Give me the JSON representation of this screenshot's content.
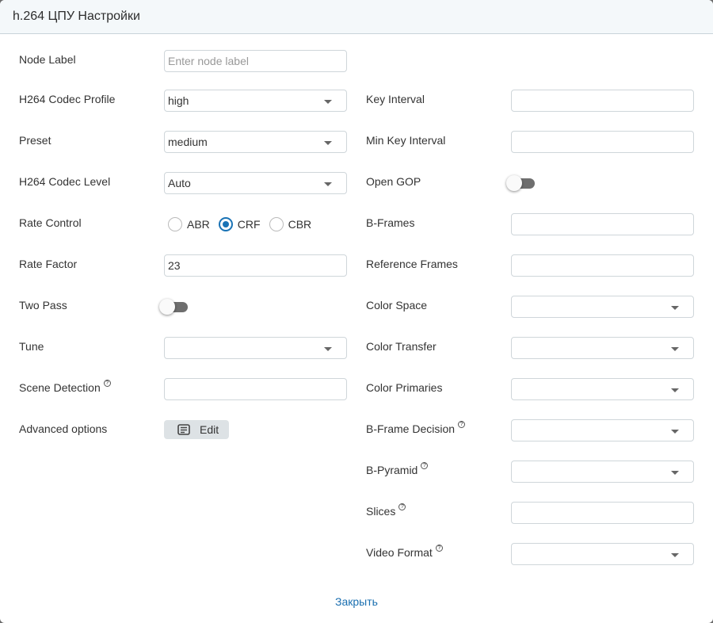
{
  "dialog": {
    "title": "h.264 ЦПУ Настройки",
    "close_label": "Закрыть"
  },
  "left": {
    "node_label": {
      "label": "Node Label",
      "value": "",
      "placeholder": "Enter node label"
    },
    "profile": {
      "label": "H264 Codec Profile",
      "value": "high"
    },
    "preset": {
      "label": "Preset",
      "value": "medium"
    },
    "level": {
      "label": "H264 Codec Level",
      "value": "Auto"
    },
    "rate_control": {
      "label": "Rate Control",
      "options": [
        "ABR",
        "CRF",
        "CBR"
      ],
      "selected": "CRF"
    },
    "rate_factor": {
      "label": "Rate Factor",
      "value": "23"
    },
    "two_pass": {
      "label": "Two Pass",
      "on": false
    },
    "tune": {
      "label": "Tune",
      "value": ""
    },
    "scene_detection": {
      "label": "Scene Detection",
      "value": "",
      "help_icon": "question-circle-icon"
    },
    "advanced": {
      "label": "Advanced options",
      "button": "Edit",
      "icon": "notes-icon"
    }
  },
  "right": {
    "key_interval": {
      "label": "Key Interval",
      "value": ""
    },
    "min_key_interval": {
      "label": "Min Key Interval",
      "value": ""
    },
    "open_gop": {
      "label": "Open GOP",
      "on": false
    },
    "b_frames": {
      "label": "B-Frames",
      "value": ""
    },
    "ref_frames": {
      "label": "Reference Frames",
      "value": ""
    },
    "color_space": {
      "label": "Color Space",
      "value": ""
    },
    "color_transfer": {
      "label": "Color Transfer",
      "value": ""
    },
    "color_primaries": {
      "label": "Color Primaries",
      "value": ""
    },
    "b_frame_decision": {
      "label": "B-Frame Decision",
      "value": ""
    },
    "b_pyramid": {
      "label": "B-Pyramid",
      "value": ""
    },
    "slices": {
      "label": "Slices",
      "value": ""
    },
    "video_format": {
      "label": "Video Format",
      "value": ""
    }
  },
  "colors": {
    "accent": "#1a73b5",
    "link": "#1a6fb0",
    "header_bg": "#f4f8fa",
    "toggle_off": "#6e6e6e"
  }
}
